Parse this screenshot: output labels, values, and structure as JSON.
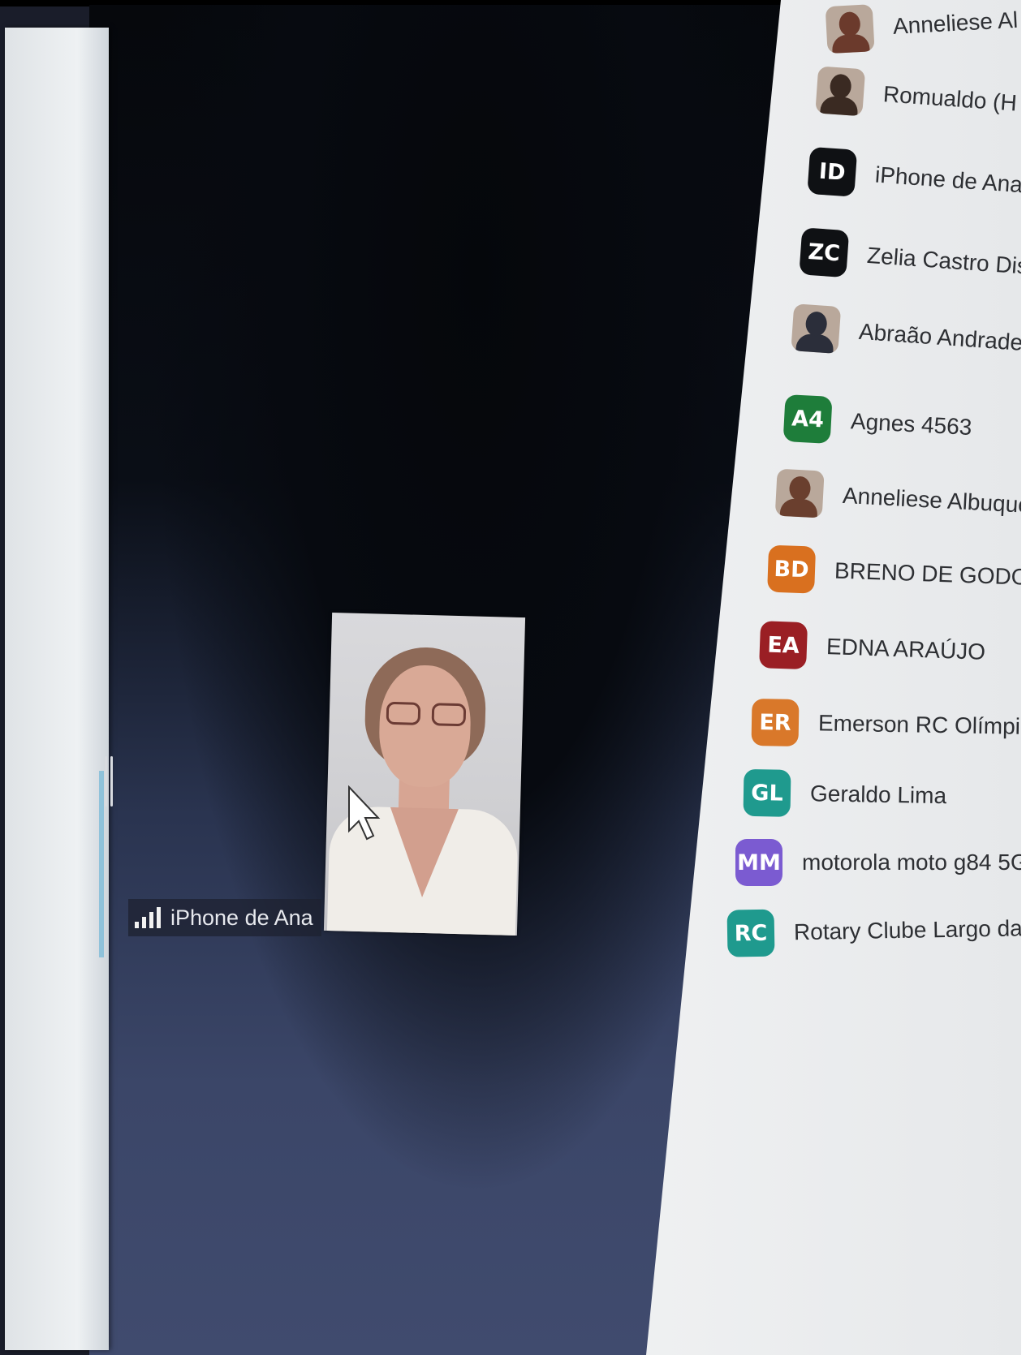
{
  "video": {
    "participant_label": "iPhone de Ana"
  },
  "participants": [
    {
      "initials": "",
      "name": "Anneliese Al",
      "avatar": "photo",
      "color": "#6b3a2c"
    },
    {
      "initials": "",
      "name": "Romualdo (H",
      "avatar": "photo",
      "color": "#3a2a22"
    },
    {
      "initials": "ID",
      "name": "iPhone de Ana",
      "avatar": "initials",
      "color": "#0f1114"
    },
    {
      "initials": "ZC",
      "name": "Zelia Castro Dis",
      "avatar": "initials",
      "color": "#0f1114"
    },
    {
      "initials": "",
      "name": "Abraão Andrade",
      "avatar": "photo",
      "color": "#2b2e3a"
    },
    {
      "initials": "A4",
      "name": "Agnes 4563",
      "avatar": "initials",
      "color": "#1e7d3a"
    },
    {
      "initials": "",
      "name": "Anneliese Albuquer",
      "avatar": "photo",
      "color": "#6a3f2e"
    },
    {
      "initials": "BD",
      "name": "BRENO DE GODOY N",
      "avatar": "initials",
      "color": "#d9701f"
    },
    {
      "initials": "EA",
      "name": "EDNA ARAÚJO",
      "avatar": "initials",
      "color": "#9a1f24"
    },
    {
      "initials": "ER",
      "name": "Emerson RC Olímpia",
      "avatar": "initials",
      "color": "#d9782a"
    },
    {
      "initials": "GL",
      "name": "Geraldo Lima",
      "avatar": "initials",
      "color": "#1f9a8e"
    },
    {
      "initials": "MM",
      "name": "motorola moto g84 5G",
      "avatar": "initials",
      "color": "#7b5bd1"
    },
    {
      "initials": "RC",
      "name": "Rotary Clube Largo da Paz",
      "avatar": "initials",
      "color": "#1f9a8e"
    }
  ]
}
